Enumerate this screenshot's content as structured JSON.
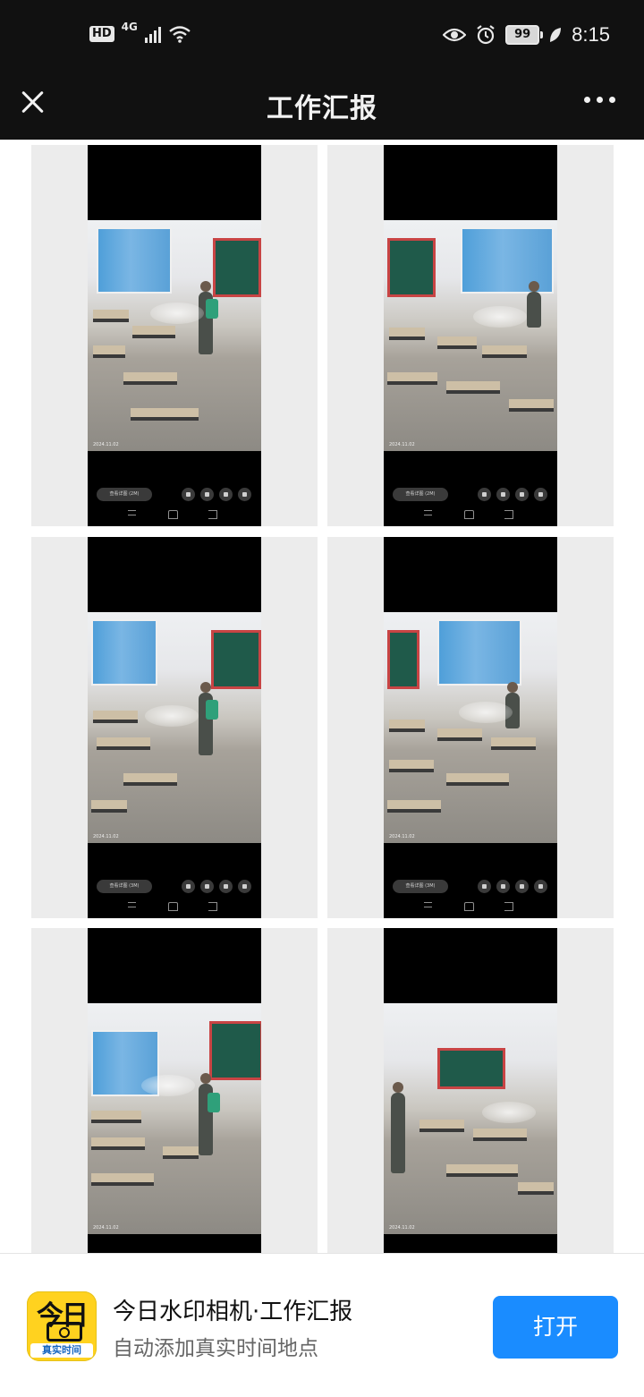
{
  "status_bar": {
    "hd": "HD",
    "network": "4G",
    "battery": "99",
    "time": "8:15",
    "icons": [
      "signal-icon",
      "wifi-icon",
      "eye-icon",
      "alarm-icon",
      "battery-icon",
      "leaf-icon"
    ]
  },
  "header": {
    "title": "工作汇报",
    "left_icon": "close-icon",
    "right_icon": "more-icon"
  },
  "photos": [
    {
      "stamp": "2024.11.02",
      "pill": "查看详图 (2M)"
    },
    {
      "stamp": "2024.11.02",
      "pill": "查看详图 (2M)"
    },
    {
      "stamp": "2024.11.02",
      "pill": "查看详图 (3M)"
    },
    {
      "stamp": "2024.11.02",
      "pill": "查看详图 (3M)"
    },
    {
      "stamp": "2024.11.02",
      "pill": ""
    },
    {
      "stamp": "2024.11.02",
      "pill": ""
    }
  ],
  "banner": {
    "logo_text": "今日",
    "logo_caption": "真实时间",
    "app_name": "今日水印相机·工作汇报",
    "app_desc": "自动添加真实时间地点",
    "open_label": "打开"
  }
}
